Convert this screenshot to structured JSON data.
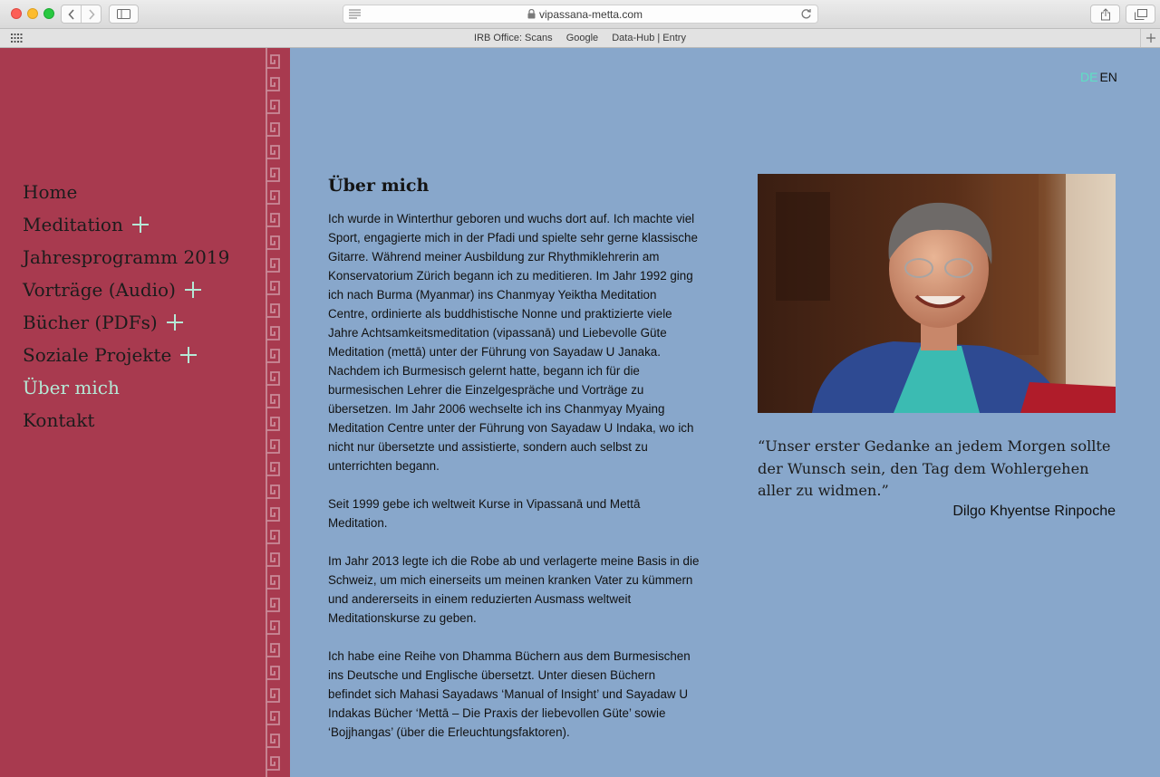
{
  "browser": {
    "url": "vipassana-metta.com",
    "bookmarks": [
      "IRB Office: Scans",
      "Google",
      "Data-Hub | Entry"
    ]
  },
  "language": {
    "de": "DE",
    "en": "EN",
    "active": "DE"
  },
  "nav": {
    "items": [
      {
        "label": "Home",
        "expandable": false,
        "active": false
      },
      {
        "label": "Meditation",
        "expandable": true,
        "active": false
      },
      {
        "label": "Jahresprogramm 2019",
        "expandable": false,
        "active": false
      },
      {
        "label": "Vorträge (Audio)",
        "expandable": true,
        "active": false
      },
      {
        "label": "Bücher (PDFs)",
        "expandable": true,
        "active": false
      },
      {
        "label": "Soziale Projekte",
        "expandable": true,
        "active": false
      },
      {
        "label": "Über mich",
        "expandable": false,
        "active": true
      },
      {
        "label": "Kontakt",
        "expandable": false,
        "active": false
      }
    ]
  },
  "content": {
    "title": "Über mich",
    "paragraphs": [
      "Ich wurde in Winterthur geboren und wuchs dort auf. Ich machte viel Sport, engagierte mich in der Pfadi und spielte sehr gerne klassische Gitarre. Während meiner Ausbildung zur Rhythmiklehrerin am Konservatorium Zürich begann ich zu meditieren. Im Jahr 1992 ging ich nach Burma (Myanmar) ins Chanmyay Yeiktha Meditation Centre, ordinierte als buddhistische Nonne und praktizierte viele Jahre Achtsamkeitsmeditation (vipassanā) und Liebevolle Güte Meditation (mettā) unter der Führung von Sayadaw U Janaka. Nachdem ich Burmesisch gelernt hatte, begann ich für die burmesischen Lehrer die Einzelgespräche und Vorträge zu übersetzen. Im Jahr 2006 wechselte ich ins Chanmyay Myaing Meditation Centre unter der Führung von Sayadaw U Indaka, wo ich nicht nur übersetzte und assistierte, sondern auch selbst zu unterrichten begann.",
      "Seit 1999 gebe ich weltweit Kurse in Vipassanā und Mettā Meditation.",
      "Im Jahr 2013 legte ich die Robe ab und verlagerte meine Basis in die Schweiz, um mich einerseits um meinen kranken Vater zu kümmern und andererseits in einem reduzierten Ausmass weltweit Meditationskurse zu geben.",
      "Ich habe eine Reihe von Dhamma Büchern aus dem Burmesischen ins Deutsche und Englische übersetzt. Unter diesen Büchern befindet sich Mahasi Sayadaws ‘Manual of Insight’ und Sayadaw U Indakas Bücher ‘Mettā – Die Praxis der liebevollen Güte’ sowie ‘Bojjhangas’ (über die Erleuchtungsfaktoren)."
    ]
  },
  "quote": {
    "text": "“Unser erster Gedanke an jedem Morgen sollte der Wunsch sein, den Tag dem Wohlergehen aller zu widmen.”",
    "author": "Dilgo Khyentse Rinpoche"
  },
  "colors": {
    "sidebar": "#a83a4f",
    "page_background": "#88a7cb",
    "nav_active": "#b5e9d6",
    "lang_active": "#5ee0c4"
  }
}
